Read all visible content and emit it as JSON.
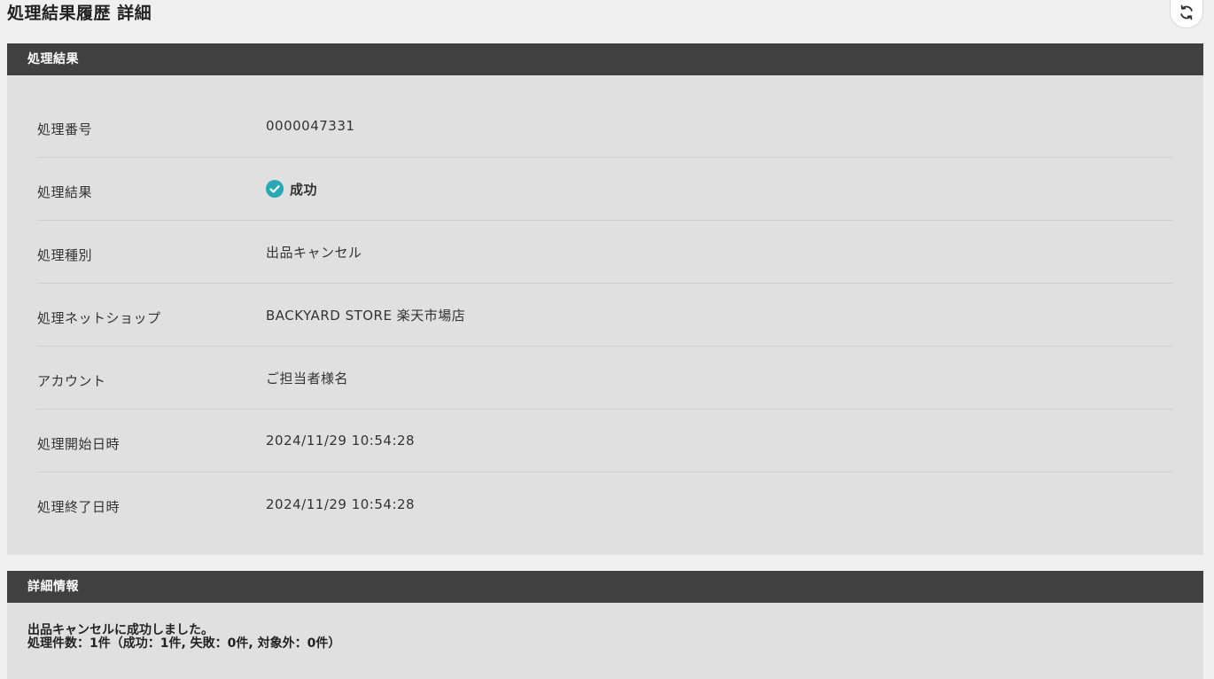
{
  "page": {
    "title": "処理結果履歴 詳細",
    "refresh_icon": "refresh-icon"
  },
  "result_section": {
    "header": "処理結果",
    "rows": [
      {
        "label": "処理番号",
        "value": "0000047331"
      },
      {
        "label": "処理結果",
        "value": "成功",
        "icon": "check-circle-icon",
        "icon_color": "#2aa8b8"
      },
      {
        "label": "処理種別",
        "value": "出品キャンセル"
      },
      {
        "label": "処理ネットショップ",
        "value": "BACKYARD STORE 楽天市場店"
      },
      {
        "label": "アカウント",
        "value": "ご担当者様名"
      },
      {
        "label": "処理開始日時",
        "value": "2024/11/29 10:54:28"
      },
      {
        "label": "処理終了日時",
        "value": "2024/11/29 10:54:28"
      }
    ]
  },
  "detail_section": {
    "header": "詳細情報",
    "lines": [
      "出品キャンセルに成功しました。",
      "処理件数：1件（成功：1件, 失敗：0件, 対象外：0件）"
    ]
  },
  "colors": {
    "section_header_bg": "#404040",
    "section_body_bg": "#e0e0e0",
    "page_bg": "#f0f0f0",
    "success": "#2aa8b8"
  }
}
